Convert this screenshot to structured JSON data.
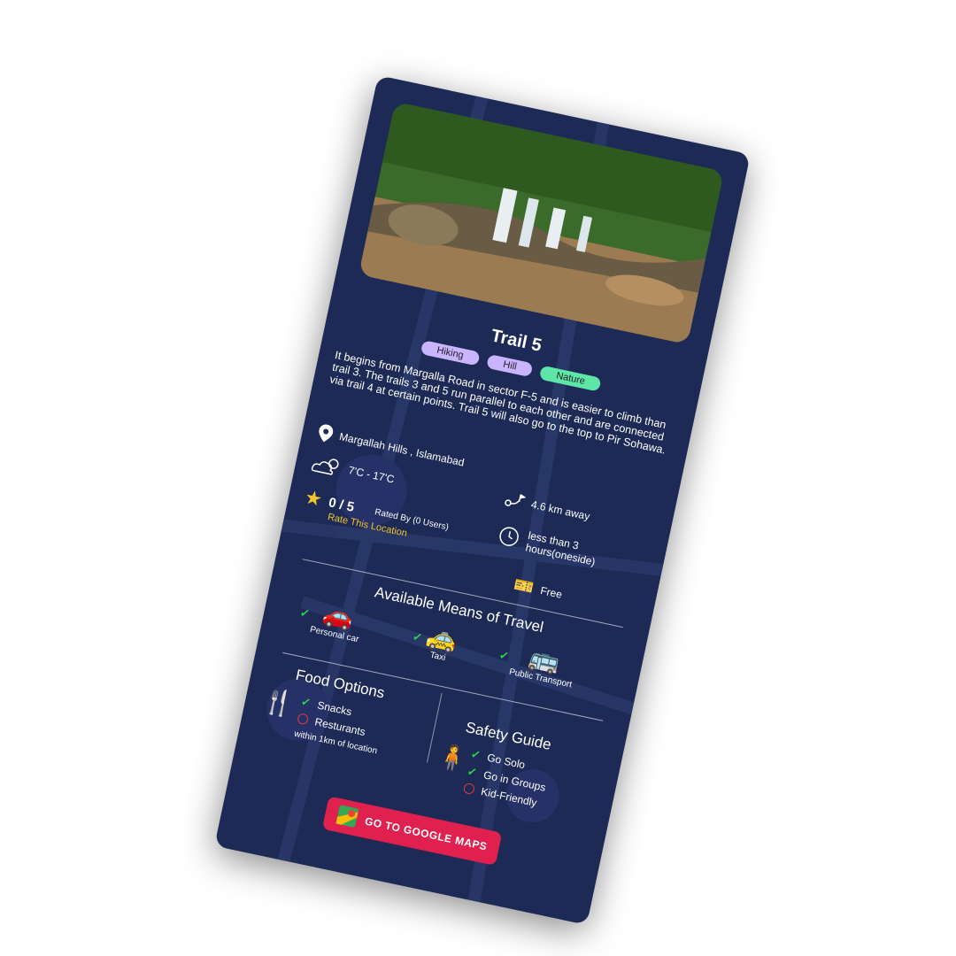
{
  "trail": {
    "name": "Trail 5",
    "tags": [
      "Hiking",
      "Hill",
      "Nature"
    ],
    "description": "It begins from Margalla Road in sector F-5 and is easier to climb than trail 3. The trails 3 and 5 run parallel to each other and are connected via trail 4 at certain points. Trail 5 will also go to the top to Pir Sohawa.",
    "location": "Margallah Hills , Islamabad",
    "temperature": "7'C - 17'C",
    "rating": "0 / 5",
    "rated_by": "Rated By (0 Users)",
    "rate_link": "Rate This Location",
    "distance": "4.6 km away",
    "duration": "less than 3 hours(oneside)",
    "price": "Free"
  },
  "travel": {
    "title": "Available Means of Travel",
    "options": [
      {
        "label": "Personal car",
        "available": true
      },
      {
        "label": "Taxi",
        "available": true
      },
      {
        "label": "Public Transport",
        "available": true
      }
    ]
  },
  "food": {
    "title": "Food Options",
    "items": [
      {
        "label": "Snacks",
        "available": true
      },
      {
        "label": "Resturants",
        "available": false
      }
    ],
    "note": "within 1km of location"
  },
  "safety": {
    "title": "Safety Guide",
    "items": [
      {
        "label": "Go Solo",
        "available": true
      },
      {
        "label": "Go in Groups",
        "available": true
      },
      {
        "label": "Kid-Friendly",
        "available": false
      }
    ]
  },
  "button": {
    "label": "GO TO GOOGLE MAPS"
  },
  "colors": {
    "card": "#1c2a55",
    "accent": "#e0204f",
    "tag_purple": "#c9b4ff",
    "tag_green": "#5ee6a8",
    "check": "#2bd94a",
    "cross": "#e23b3b",
    "star": "#f4c430"
  }
}
